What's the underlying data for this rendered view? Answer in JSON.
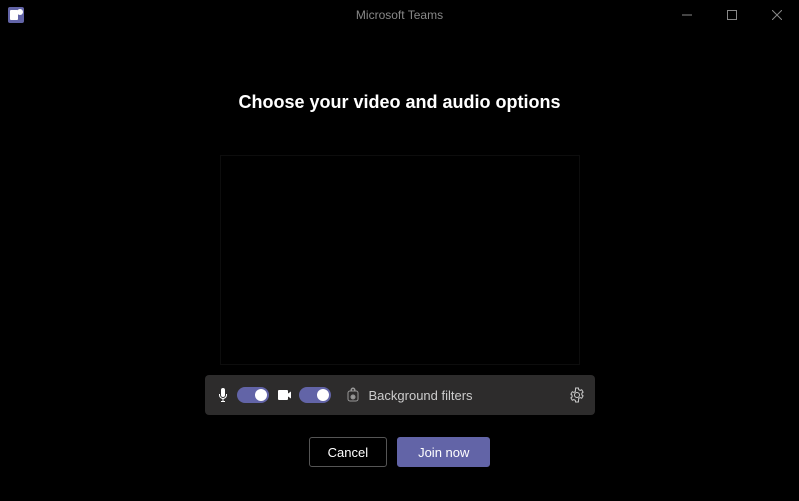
{
  "titlebar": {
    "title": "Microsoft Teams"
  },
  "heading": "Choose your video and audio options",
  "controls": {
    "mic_on": true,
    "camera_on": true,
    "background_filters_label": "Background filters"
  },
  "actions": {
    "cancel_label": "Cancel",
    "join_label": "Join now"
  }
}
